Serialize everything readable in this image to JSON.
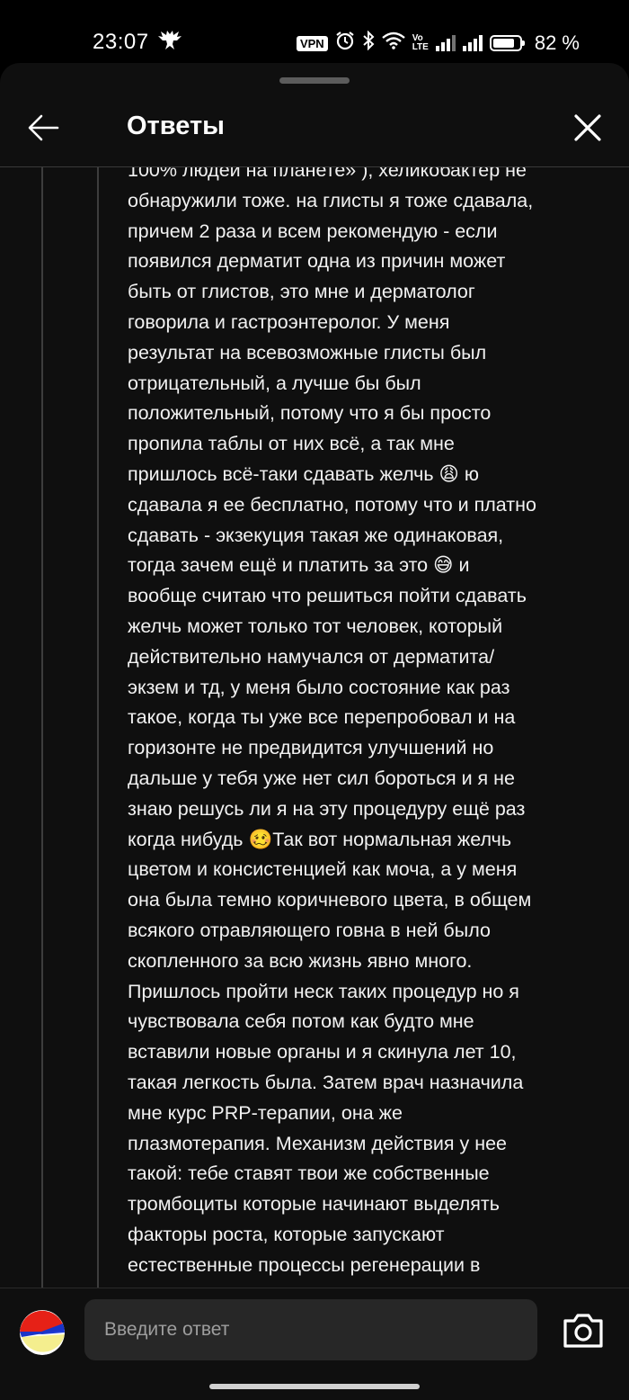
{
  "status_bar": {
    "time": "23:07",
    "vpn_label": "VPN",
    "volte_label": "Vo\nLTE",
    "battery_percent": 82,
    "battery_text": "82 %",
    "icons": [
      "eagle-icon",
      "alarm-icon",
      "bluetooth-icon",
      "wifi-icon",
      "volte-icon",
      "signal-icon",
      "battery-icon"
    ]
  },
  "header": {
    "title": "Ответы",
    "back_icon": "arrow-left-icon",
    "close_icon": "close-icon"
  },
  "reply": {
    "text": "100% людей на планете» ), хеликобактер не\nобнаружили тоже. на глисты я тоже сдавала,\nпричем 2 раза и всем рекомендую - если\nпоявился дерматит одна из причин может\nбыть от глистов, это мне и дерматолог\nговорила и гастроэнтеролог. У меня\nрезультат на всевозможные глисты был\nотрицательный, а лучше бы был\nположительный, потому что я бы просто\nпропила таблы от них всё, а так мне\nпришлось всё-таки сдавать желчь 😩 ю\nсдавала я ее бесплатно, потому что и платно\nсдавать - экзекуция такая же одинаковая,\nтогда зачем ещё и платить за это 😅 и\nвообще считаю что решиться пойти сдавать\nжелчь может только тот человек, который\nдействительно намучался от дерматита/\nэкзем и тд, у меня было состояние как раз\nтакое, когда ты уже все перепробовал и на\nгоризонте не предвидится улучшений но\nдальше у тебя уже нет сил бороться и я не\nзнаю решусь ли я на эту процедуру ещё раз\nкогда нибудь 🥴Так вот нормальная желчь\nцветом и консистенцией как моча, а у меня\nона была темно коричневого цвета, в общем\nвсякого отравляющего говна в ней было\nскопленного за всю жизнь явно много.\nПришлось пройти неск таких процедур но я\nчувствовала себя потом как будто мне\nвставили новые органы и я скинула лет 10,\nтакая легкость была. Затем врач назначила\nмне курс PRP-терапии, она же\nплазмотерапия. Механизм действия у нее\nтакой: тебе ставят твои же собственные\nтромбоциты которые начинают выделять\nфакторы роста, которые запускают\nестественные процессы регенерации в"
  },
  "composer": {
    "placeholder": "Введите ответ",
    "value": "",
    "camera_icon": "camera-icon",
    "avatar_icon": "avatar-icon"
  },
  "colors": {
    "background": "#0f0f0f",
    "input_background": "#272727",
    "thread_line": "#3d3d3d",
    "text": "#f1f1f1",
    "placeholder": "#9e9e9e"
  }
}
